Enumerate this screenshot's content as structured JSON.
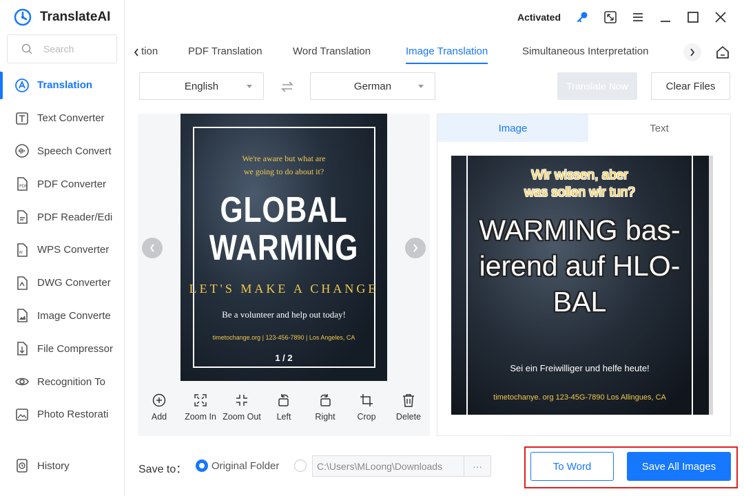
{
  "app": {
    "name": "TranslateAI",
    "status": "Activated"
  },
  "search": {
    "placeholder": "Search"
  },
  "sidebar": {
    "items": [
      {
        "label": "Translation",
        "icon": "translate-icon",
        "active": true
      },
      {
        "label": "Text Converter",
        "icon": "text-converter-icon"
      },
      {
        "label": "Speech Convert",
        "icon": "speech-icon"
      },
      {
        "label": "PDF Converter",
        "icon": "pdf-icon"
      },
      {
        "label": "PDF Reader/Edi",
        "icon": "pdf-reader-icon"
      },
      {
        "label": "WPS Converter",
        "icon": "wps-icon"
      },
      {
        "label": "DWG Converter",
        "icon": "dwg-icon"
      },
      {
        "label": "Image Converte",
        "icon": "image-icon"
      },
      {
        "label": "File Compressor",
        "icon": "compress-icon"
      },
      {
        "label": "Recognition To",
        "icon": "eye-icon"
      },
      {
        "label": "Photo Restorati",
        "icon": "photo-icon"
      }
    ],
    "history_label": "History"
  },
  "tabs": {
    "items": [
      "tion",
      "PDF Translation",
      "Word Translation",
      "Image Translation",
      "Simultaneous Interpretation"
    ],
    "active_index": 3
  },
  "languages": {
    "source": "English",
    "target": "German"
  },
  "actions": {
    "translate_now": "Translate Now",
    "clear_files": "Clear Files"
  },
  "source_image": {
    "top_text_1": "We're aware but what are",
    "top_text_2": "we going to do about it?",
    "title_1": "GLOBAL",
    "title_2": "WARMING",
    "subtitle": "LET'S MAKE A CHANGE",
    "volunteer": "Be a volunteer and help out today!",
    "contact": "timetochange.org  |  123-456-7890  |  Los Angeles, CA",
    "page": "1 / 2"
  },
  "tools": [
    "Add",
    "Zoom In",
    "Zoom Out",
    "Left",
    "Right",
    "Crop",
    "Delete"
  ],
  "result_tabs": {
    "image": "Image",
    "text": "Text"
  },
  "translated_image": {
    "top_text_1": "Wir wissen, aber",
    "top_text_2": "was sollen wir tun?",
    "title_1": "WARMING bas-",
    "title_2": "ierend auf HLO-",
    "title_3": "BAL",
    "volunteer": "Sei ein Freiwilliger und helfe heute!",
    "contact": "timetochanye. org 123-45G-7890 Los Allingues, CA"
  },
  "save": {
    "label": "Save to：",
    "original_folder": "Original Folder",
    "path": "C:\\Users\\MLoong\\Downloads",
    "browse": "···"
  },
  "export": {
    "to_word": "To Word",
    "save_all": "Save All Images"
  },
  "colors": {
    "accent": "#1677ff",
    "highlight": "#e02020",
    "poster_yellow": "#f2c94c"
  }
}
